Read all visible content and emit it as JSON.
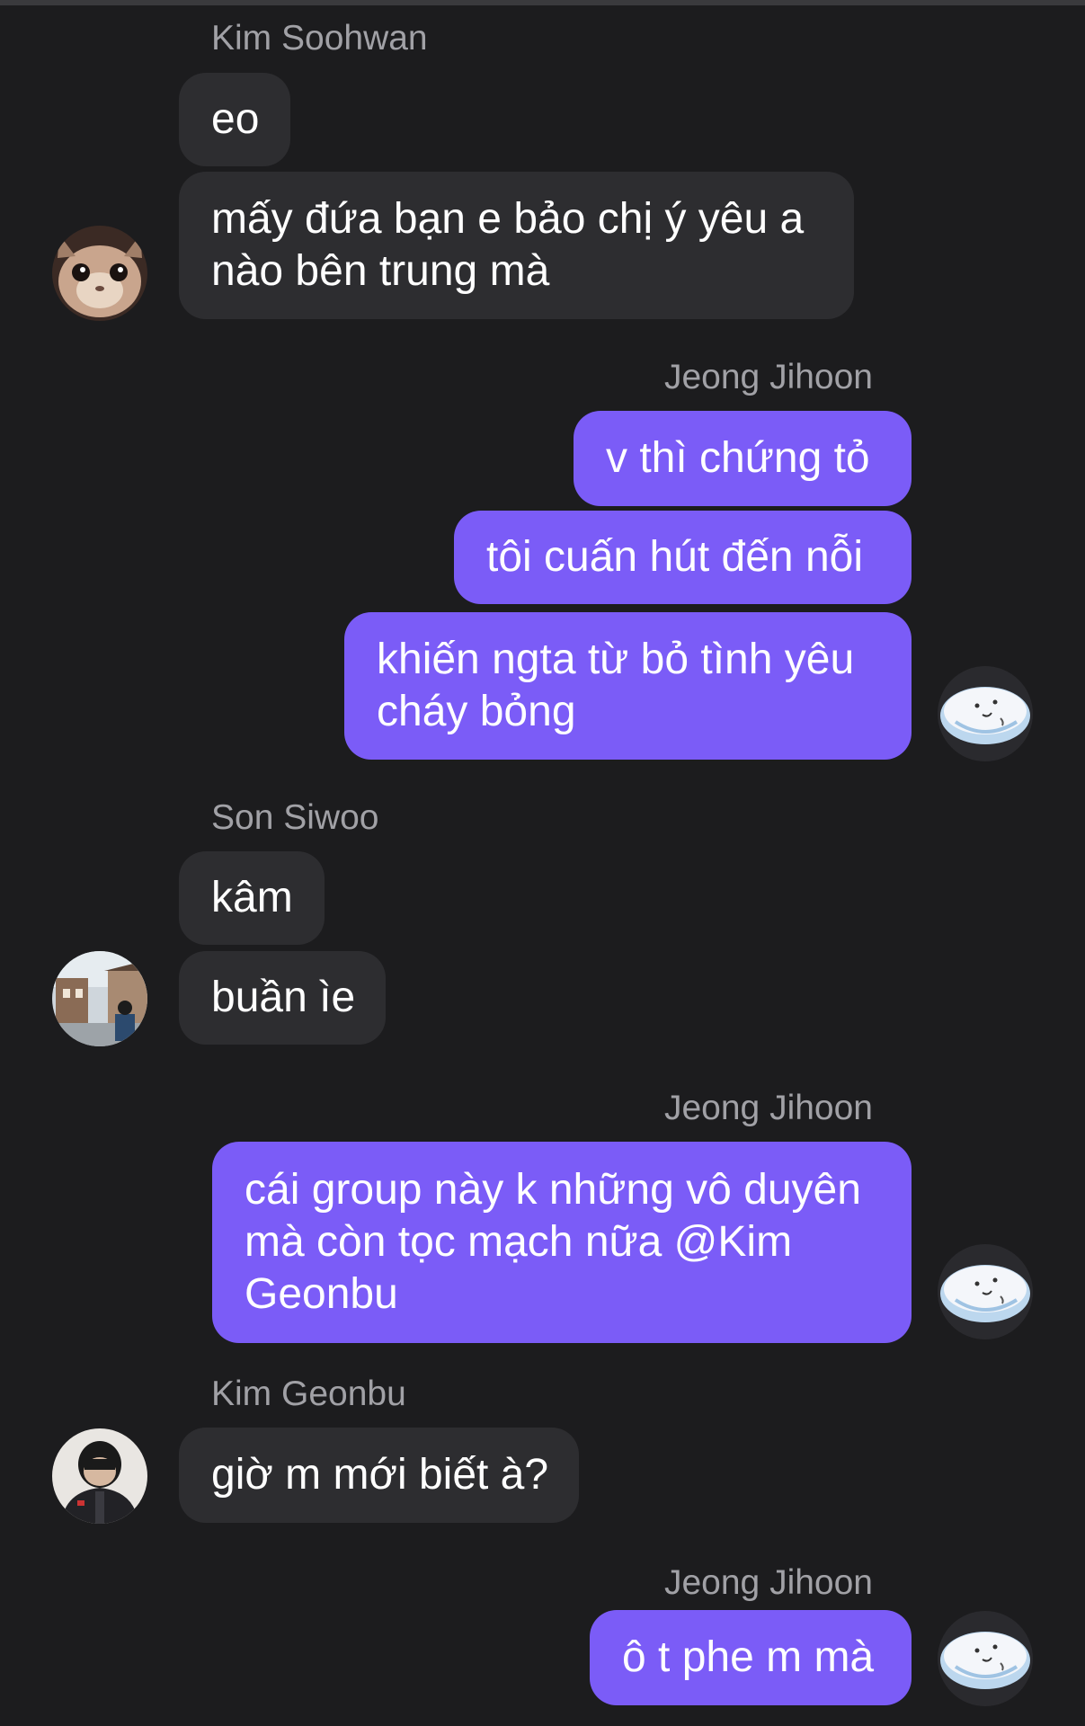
{
  "chat": {
    "messages": [
      {
        "sender": "Kim Soohwan",
        "side": "in",
        "texts": [
          "eo",
          "mấy đứa bạn e bảo chị ý yêu a nào bên trung mà"
        ]
      },
      {
        "sender": "Jeong Jihoon",
        "side": "out",
        "texts": [
          "v thì chứng tỏ",
          "tôi cuấn hút đến nỗi",
          "khiến ngta từ bỏ tình yêu cháy bỏng"
        ]
      },
      {
        "sender": "Son Siwoo",
        "side": "in",
        "texts": [
          "kâm",
          "buần ìe"
        ]
      },
      {
        "sender": "Jeong Jihoon",
        "side": "out",
        "texts": [
          "cái group này k những vô duyên mà còn tọc mạch nữa @Kim Geonbu"
        ]
      },
      {
        "sender": "Kim Geonbu",
        "side": "in",
        "texts": [
          "giờ m mới biết à?"
        ]
      },
      {
        "sender": "Jeong Jihoon",
        "side": "out",
        "texts": [
          "ô t phe m mà"
        ]
      }
    ]
  },
  "colors": {
    "background": "#1c1c1e",
    "incoming_bubble": "#2d2d30",
    "outgoing_bubble": "#7b5cf7",
    "sender_name": "#a1a1a6"
  },
  "avatars": {
    "kim_soohwan": "cat-photo",
    "jeong_jihoon": "cartoon-blob",
    "son_siwoo": "street-photo",
    "kim_geonbu": "person-photo"
  }
}
